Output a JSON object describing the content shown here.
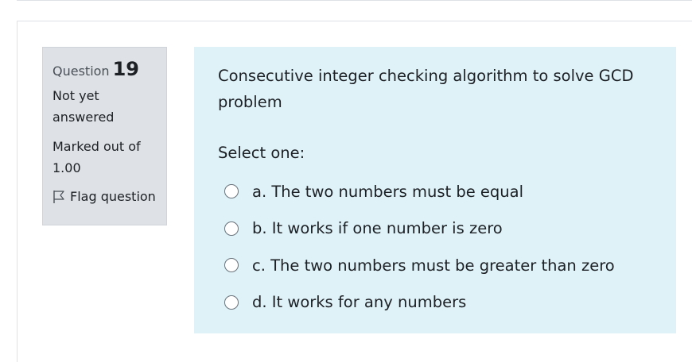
{
  "question": {
    "label": "Question",
    "number": "19",
    "state": "Not yet answered",
    "grade": "Marked out of 1.00",
    "flag_label": "Flag question",
    "text": "Consecutive integer checking algorithm to solve GCD problem",
    "prompt": "Select one:",
    "options": [
      {
        "label": "a. The two numbers must be equal",
        "selected": false
      },
      {
        "label": "b. It works if one number is zero",
        "selected": false
      },
      {
        "label": "c. The two numbers must be greater than zero",
        "selected": false
      },
      {
        "label": "d. It works for any numbers",
        "selected": false
      }
    ]
  },
  "icons": {
    "flag": "flag-icon",
    "radio": "radio-unchecked"
  },
  "colors": {
    "info_background": "#dee2e6",
    "content_background": "#def2f8",
    "text": "#1d2125"
  }
}
